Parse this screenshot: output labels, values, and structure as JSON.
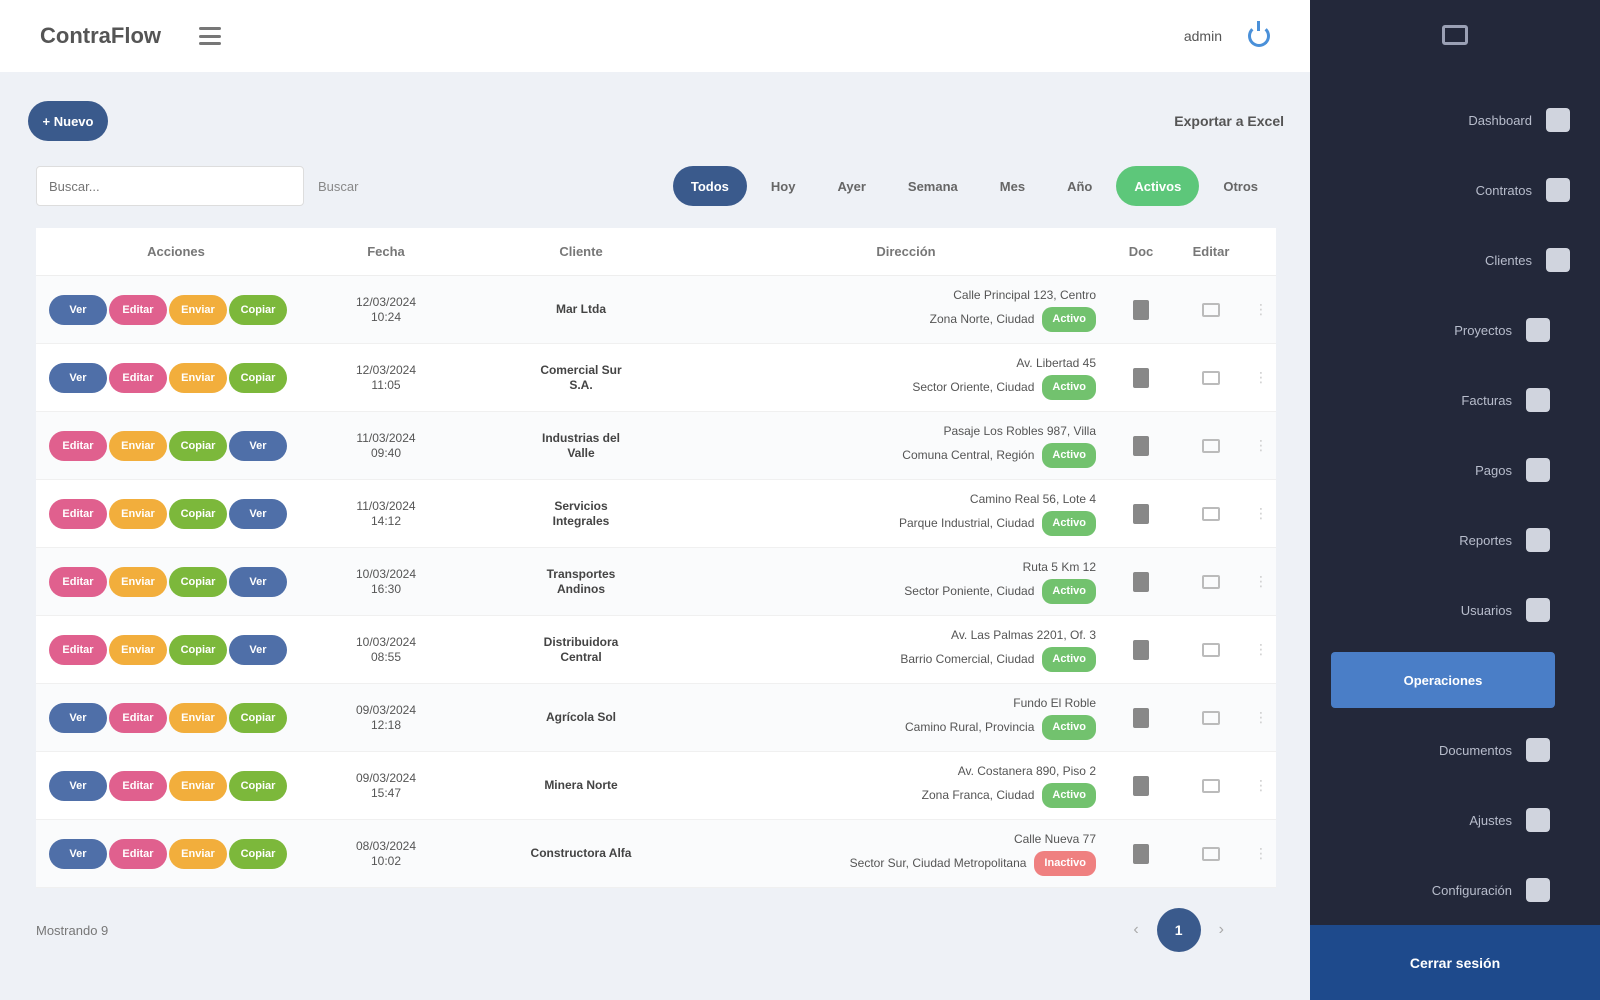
{
  "header": {
    "brand": "ContraFlow",
    "user": "admin"
  },
  "toolbar": {
    "new_label": "+ Nuevo",
    "export_label": "Exportar a Excel"
  },
  "filters": {
    "search_placeholder": "Buscar...",
    "search_button": "Buscar",
    "chips": [
      "Todos",
      "Hoy",
      "Ayer",
      "Semana",
      "Mes",
      "Año",
      "Activos",
      "Otros"
    ]
  },
  "table": {
    "columns": [
      "Acciones",
      "Fecha",
      "Cliente",
      "Dirección",
      "Doc",
      "Editar",
      ""
    ],
    "rows": [
      {
        "chips": [
          "Ver",
          "Editar",
          "Enviar",
          "Copiar"
        ],
        "date": "12/03/2024\n10:24",
        "client": "Mar Ltda",
        "addr1": "Calle Principal 123, Centro",
        "addr2": "Zona Norte, Ciudad",
        "status": "Activo",
        "red": false
      },
      {
        "chips": [
          "Ver",
          "Editar",
          "Enviar",
          "Copiar"
        ],
        "date": "12/03/2024\n11:05",
        "client": "Comercial Sur\nS.A.",
        "addr1": "Av. Libertad 45",
        "addr2": "Sector Oriente, Ciudad",
        "status": "Activo",
        "red": false
      },
      {
        "chips": [
          "Editar",
          "Enviar",
          "Copiar",
          "Ver"
        ],
        "date": "11/03/2024\n09:40",
        "client": "Industrias del\nValle",
        "addr1": "Pasaje Los Robles 987, Villa",
        "addr2": "Comuna Central, Región",
        "status": "Activo",
        "red": false
      },
      {
        "chips": [
          "Editar",
          "Enviar",
          "Copiar",
          "Ver"
        ],
        "date": "11/03/2024\n14:12",
        "client": "Servicios\nIntegrales",
        "addr1": "Camino Real 56, Lote 4",
        "addr2": "Parque Industrial, Ciudad",
        "status": "Activo",
        "red": false
      },
      {
        "chips": [
          "Editar",
          "Enviar",
          "Copiar",
          "Ver"
        ],
        "date": "10/03/2024\n16:30",
        "client": "Transportes\nAndinos",
        "addr1": "Ruta 5 Km 12",
        "addr2": "Sector Poniente, Ciudad",
        "status": "Activo",
        "red": false
      },
      {
        "chips": [
          "Editar",
          "Enviar",
          "Copiar",
          "Ver"
        ],
        "date": "10/03/2024\n08:55",
        "client": "Distribuidora\nCentral",
        "addr1": "Av. Las Palmas 2201, Of. 3",
        "addr2": "Barrio Comercial, Ciudad",
        "status": "Activo",
        "red": false
      },
      {
        "chips": [
          "Ver",
          "Editar",
          "Enviar",
          "Copiar"
        ],
        "date": "09/03/2024\n12:18",
        "client": "Agrícola Sol",
        "addr1": "Fundo El Roble",
        "addr2": "Camino Rural, Provincia",
        "status": "Activo",
        "red": false
      },
      {
        "chips": [
          "Ver",
          "Editar",
          "Enviar",
          "Copiar"
        ],
        "date": "09/03/2024\n15:47",
        "client": "Minera Norte",
        "addr1": "Av. Costanera 890, Piso 2",
        "addr2": "Zona Franca, Ciudad",
        "status": "Activo",
        "red": false
      },
      {
        "chips": [
          "Ver",
          "Editar",
          "Enviar",
          "Copiar"
        ],
        "date": "08/03/2024\n10:02",
        "client": "Constructora Alfa",
        "addr1": "Calle Nueva 77",
        "addr2": "Sector Sur, Ciudad Metropolitana",
        "status": "Inactivo",
        "red": true
      }
    ]
  },
  "footer": {
    "info": "Mostrando 9",
    "page": "1"
  },
  "sidebar": {
    "items": [
      "Dashboard",
      "Contratos",
      "Clientes",
      "Proyectos",
      "Facturas",
      "Pagos",
      "Reportes",
      "Usuarios",
      "Operaciones",
      "Documentos",
      "Ajustes",
      "Configuración"
    ],
    "bottom": "Cerrar sesión"
  },
  "colors": {
    "primary": "#3a5a8c",
    "sidebar": "#23283a",
    "active": "#4a7ec7",
    "green": "#5dc77a"
  }
}
